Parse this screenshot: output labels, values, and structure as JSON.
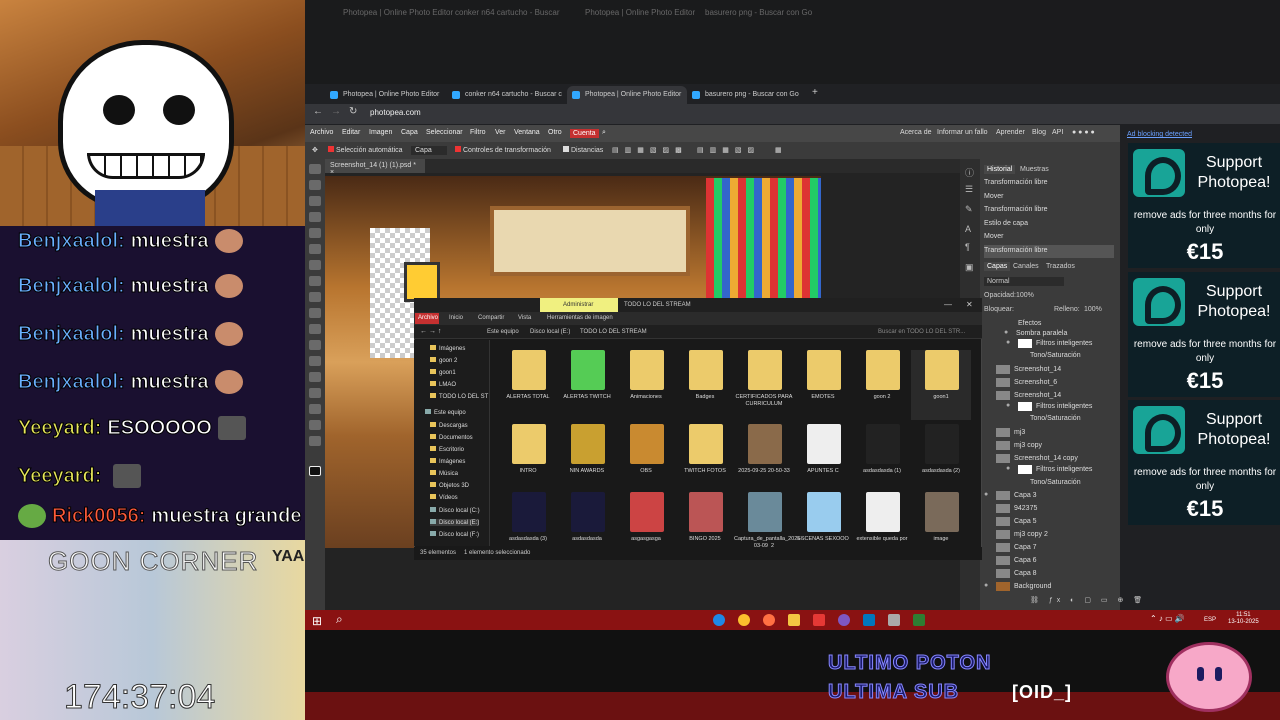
{
  "stream": {
    "chat": [
      {
        "user": "Benjxaalol:",
        "msg": "muestra",
        "color": "blue"
      },
      {
        "user": "Benjxaalol:",
        "msg": "muestra",
        "color": "blue"
      },
      {
        "user": "Benjxaalol:",
        "msg": "muestra",
        "color": "blue"
      },
      {
        "user": "Benjxaalol:",
        "msg": "muestra",
        "color": "blue"
      },
      {
        "user": "Yeeyard:",
        "msg": "ESOOOOO",
        "color": "yellow"
      },
      {
        "user": "Yeeyard:",
        "msg": "",
        "color": "yellow"
      },
      {
        "user": "Rick0056:",
        "msg": "muestra grande",
        "color": "red"
      }
    ],
    "corner_title": "GOON CORNER",
    "corner_extra": "YAA",
    "timer": "174:37:04",
    "banner_line1": "ULTIMO POTON",
    "banner_line2": "ULTIMA SUB",
    "banner_name": "[OID_]"
  },
  "bg_browser": {
    "tabs": [
      "Photopea | Online Photo Editor",
      "conker n64 cartucho - Buscar",
      "Photopea | Online Photo Editor",
      "basurero png - Buscar con Go"
    ]
  },
  "browser": {
    "tabs": [
      {
        "label": "Photopea | Online Photo Editor"
      },
      {
        "label": "conker n64 cartucho - Buscar c"
      },
      {
        "label": "Photopea | Online Photo Editor"
      },
      {
        "label": "basurero png - Buscar con Go"
      }
    ],
    "new_tab": "+",
    "url": "photopea.com"
  },
  "photopea": {
    "menu": [
      "Archivo",
      "Editar",
      "Imagen",
      "Capa",
      "Seleccionar",
      "Filtro",
      "Ver",
      "Ventana",
      "Otro",
      "Cuenta"
    ],
    "right_menu": [
      "Acerca de",
      "Informar un fallo",
      "Aprender",
      "Blog",
      "API"
    ],
    "options": {
      "auto_select": "Selección automática",
      "select_type": "Capa",
      "transform_controls": "Controles de transformación",
      "distances": "Distancias"
    },
    "doc_tab": "Screenshot_14 (1) (1).psd *",
    "history_tabs": [
      "Historial",
      "Muestras"
    ],
    "history": [
      "Transformación libre",
      "Mover",
      "Transformación libre",
      "Estilo de capa",
      "Mover",
      "Transformación libre"
    ],
    "layer_tabs": [
      "Capas",
      "Canales",
      "Trazados"
    ],
    "blend_mode": "Normal",
    "opacity_label": "Opacidad:",
    "opacity_value": "100%",
    "lock_label": "Bloquear:",
    "fill_label": "Relleno:",
    "fill_value": "100%",
    "layers": [
      "Efectos",
      "Sombra paralela",
      "Filtros inteligentes",
      "Tono/Saturación",
      "Screenshot_14",
      "Screenshot_6",
      "Screenshot_14",
      "Filtros inteligentes",
      "Tono/Saturación",
      "mj3",
      "mj3 copy",
      "Screenshot_14 copy",
      "Filtros inteligentes",
      "Tono/Saturación",
      "Capa 3",
      "942375",
      "Capa 5",
      "mj3 copy 2",
      "Capa 7",
      "Capa 6",
      "Capa 8",
      "Background"
    ],
    "ad_header": "Ad blocking detected",
    "ads": [
      {
        "title": "Support Photopea!",
        "body": "remove ads for three months for only",
        "price": "€15"
      },
      {
        "title": "Support Photopea!",
        "body": "remove ads for three months for only",
        "price": "€15"
      },
      {
        "title": "Support Photopea!",
        "body": "remove ads for three months for only",
        "price": "€15"
      }
    ]
  },
  "explorer": {
    "title_tab": "Administrar",
    "title": "TODO LO DEL STREAM",
    "ribbon": [
      "Archivo",
      "Inicio",
      "Compartir",
      "Vista",
      "Herramientas de imagen"
    ],
    "path": [
      "Este equipo",
      "Disco local (E:)",
      "TODO LO DEL STREAM"
    ],
    "search_placeholder": "Buscar en TODO LO DEL STR...",
    "sidebar": [
      "Imágenes",
      "goon 2",
      "goon1",
      "LMAO",
      "TODO LO DEL ST",
      "Este equipo",
      "Descargas",
      "Documentos",
      "Escritorio",
      "Imágenes",
      "Música",
      "Objetos 3D",
      "Vídeos",
      "Disco local (C:)",
      "Disco local (E:)",
      "Disco local (F:)"
    ],
    "items": [
      {
        "name": "ALERTAS TOTAL",
        "kind": "folder"
      },
      {
        "name": "ALERTAS TWITCH",
        "kind": "folder"
      },
      {
        "name": "Animaciones",
        "kind": "folder"
      },
      {
        "name": "Badges",
        "kind": "folder"
      },
      {
        "name": "CERTIFICADOS PARA CURRICULUM",
        "kind": "folder"
      },
      {
        "name": "EMOTES",
        "kind": "folder"
      },
      {
        "name": "goon 2",
        "kind": "folder"
      },
      {
        "name": "goon1",
        "kind": "folder"
      },
      {
        "name": "INTRO",
        "kind": "folder"
      },
      {
        "name": "NIN AWARDS",
        "kind": "folder"
      },
      {
        "name": "OBS",
        "kind": "folder"
      },
      {
        "name": "TWITCH FOTOS",
        "kind": "folder"
      },
      {
        "name": "2025-09-25 20-50-33",
        "kind": "img"
      },
      {
        "name": "APUNTES C",
        "kind": "file"
      },
      {
        "name": "asdasdasda (1)",
        "kind": "img"
      },
      {
        "name": "asdasdasda (2)",
        "kind": "img"
      },
      {
        "name": "asdasdasda (3)",
        "kind": "img"
      },
      {
        "name": "asdasdasda",
        "kind": "img"
      },
      {
        "name": "asgasgasga",
        "kind": "img"
      },
      {
        "name": "BINGO 2025",
        "kind": "img"
      },
      {
        "name": "Captura_de_pantalla_2025-03-09_2",
        "kind": "img"
      },
      {
        "name": "ESCENAS SEXOOO",
        "kind": "file"
      },
      {
        "name": "extensible queda por",
        "kind": "file"
      },
      {
        "name": "image",
        "kind": "img"
      }
    ],
    "status": [
      "35 elementos",
      "1 elemento seleccionado"
    ]
  },
  "taskbar": {
    "lang": "ESP",
    "time": "11:51",
    "date": "13-10-2025"
  }
}
